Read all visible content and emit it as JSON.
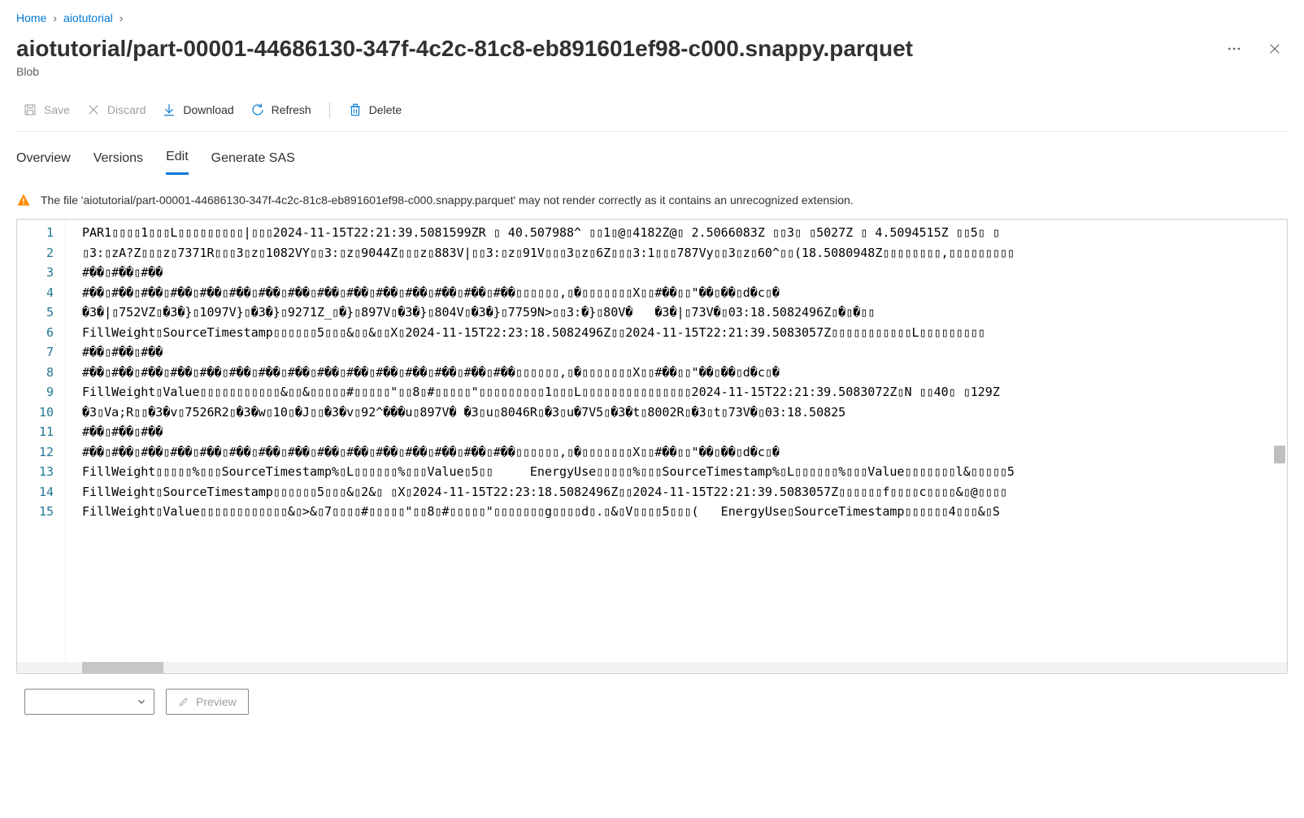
{
  "breadcrumb": {
    "items": [
      "Home",
      "aiotutorial"
    ]
  },
  "header": {
    "title": "aiotutorial/part-00001-44686130-347f-4c2c-81c8-eb891601ef98-c000.snappy.parquet",
    "subtitle": "Blob"
  },
  "toolbar": {
    "save": "Save",
    "discard": "Discard",
    "download": "Download",
    "refresh": "Refresh",
    "delete": "Delete"
  },
  "tabs": {
    "overview": "Overview",
    "versions": "Versions",
    "edit": "Edit",
    "generate_sas": "Generate SAS"
  },
  "warning": {
    "text": "The file 'aiotutorial/part-00001-44686130-347f-4c2c-81c8-eb891601ef98-c000.snappy.parquet' may not render correctly as it contains an unrecognized extension."
  },
  "editor": {
    "lines": [
      "PAR1▯▯▯▯1▯▯▯L▯▯▯▯▯▯▯▯▯|▯▯▯2024-11-15T22:21:39.5081599ZR ▯ 40.507988^ ▯▯1▯@▯4182Z@▯ 2.5066083Z ▯▯3▯ ▯5027Z ▯ 4.5094515Z ▯▯5▯ ▯",
      "▯3:▯zA?Z▯▯▯z▯7371R▯▯▯3▯z▯1082VY▯▯3:▯z▯9044Z▯▯▯z▯883V|▯▯3:▯z▯91V▯▯▯3▯z▯6Z▯▯▯3:1▯▯▯787Vy▯▯3▯z▯60^▯▯(18.5080948Z▯▯▯▯▯▯▯▯,▯▯▯▯▯▯▯▯▯",
      "#��▯#��▯#��",
      "#��▯#��▯#��▯#��▯#��▯#��▯#��▯#��▯#��▯#��▯#��▯#��▯#��▯#��▯#��▯▯▯▯▯▯,▯�▯▯▯▯▯▯▯X▯▯#��▯▯\"��▯��▯d�c▯�",
      "�3�|▯752VZ▯�3�}▯1097V}▯�3�}▯9271Z_▯�}▯897V▯�3�}▯804V▯�3�}▯7759N>▯▯3:�}▯80V�   �3�|▯73V�▯03:18.5082496Z▯�▯�▯▯",
      "FillWeight▯SourceTimestamp▯▯▯▯▯▯5▯▯▯&▯▯&▯▯X▯2024-11-15T22:23:18.5082496Z▯▯2024-11-15T22:21:39.5083057Z▯▯▯▯▯▯▯▯▯▯▯L▯▯▯▯▯▯▯▯▯",
      "#��▯#��▯#��",
      "#��▯#��▯#��▯#��▯#��▯#��▯#��▯#��▯#��▯#��▯#��▯#��▯#��▯#��▯#��▯▯▯▯▯▯,▯�▯▯▯▯▯▯▯X▯▯#��▯▯\"��▯��▯d�c▯�",
      "FillWeight▯Value▯▯▯▯▯▯▯▯▯▯▯&▯▯&▯▯▯▯▯#▯▯▯▯▯\"▯▯8▯#▯▯▯▯▯\"▯▯▯▯▯▯▯▯▯1▯▯▯L▯▯▯▯▯▯▯▯▯▯▯▯▯▯▯2024-11-15T22:21:39.5083072Z▯N ▯▯40▯ ▯129Z",
      "�3▯Va;R▯▯�3�v▯7526R2▯�3�w▯10▯�J▯▯�3�v▯92^���u▯897V� �3▯u▯8046R▯�3▯u�7V5▯�3�t▯8002R▯�3▯t▯73V�▯03:18.50825",
      "#��▯#��▯#��",
      "#��▯#��▯#��▯#��▯#��▯#��▯#��▯#��▯#��▯#��▯#��▯#��▯#��▯#��▯#��▯▯▯▯▯▯,▯�▯▯▯▯▯▯▯X▯▯#��▯▯\"��▯��▯d�c▯�",
      "FillWeight▯▯▯▯▯%▯▯▯SourceTimestamp%▯L▯▯▯▯▯▯%▯▯▯Value▯5▯▯     EnergyUse▯▯▯▯▯%▯▯▯SourceTimestamp%▯L▯▯▯▯▯▯%▯▯▯Value▯▯▯▯▯▯▯l&▯▯▯▯▯5",
      "FillWeight▯SourceTimestamp▯▯▯▯▯▯5▯▯▯&▯2&▯ ▯X▯2024-11-15T22:23:18.5082496Z▯▯2024-11-15T22:21:39.5083057Z▯▯▯▯▯▯f▯▯▯▯c▯▯▯▯&▯@▯▯▯▯",
      "FillWeight▯Value▯▯▯▯▯▯▯▯▯▯▯▯&▯>&▯7▯▯▯▯#▯▯▯▯▯\"▯▯8▯#▯▯▯▯▯\"▯▯▯▯▯▯▯g▯▯▯▯d▯.▯&▯V▯▯▯▯5▯▯▯(   EnergyUse▯SourceTimestamp▯▯▯▯▯▯4▯▯▯&▯S"
    ]
  },
  "footer": {
    "preview": "Preview"
  }
}
